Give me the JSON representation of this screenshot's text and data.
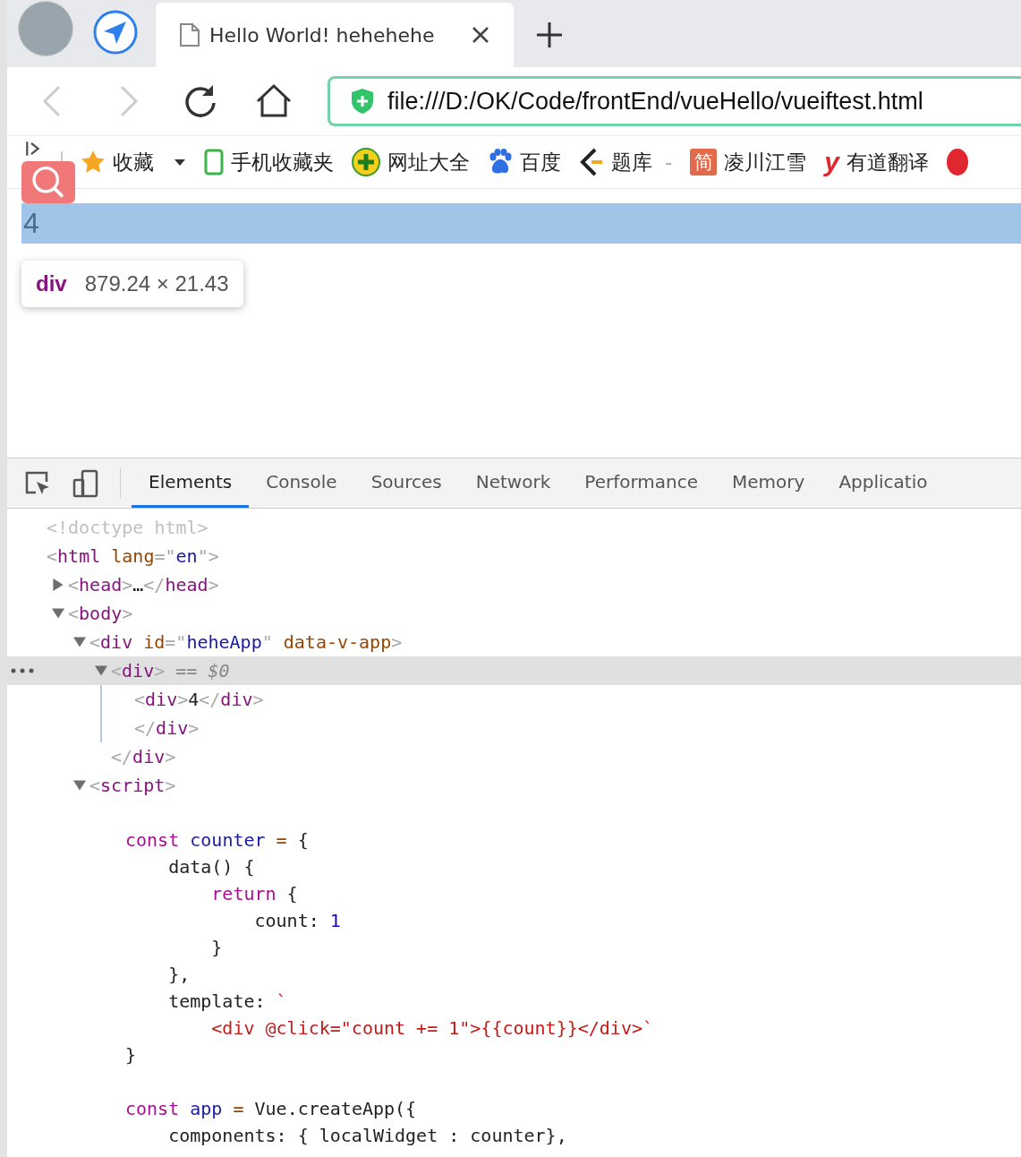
{
  "browser_tab": {
    "title": "Hello World! hehehehe",
    "selected": true
  },
  "address_bar": {
    "value": "file:///D:/OK/Code/frontEnd/vueHello/vueiftest.html"
  },
  "bookmarks": [
    {
      "kind": "star",
      "label": "收藏",
      "dropdown": true
    },
    {
      "kind": "phone",
      "label": "手机收藏夹"
    },
    {
      "kind": "plus",
      "label": "网址大全"
    },
    {
      "kind": "paw",
      "label": "百度"
    },
    {
      "kind": "bracket",
      "label": "题库",
      "suffix": "-"
    },
    {
      "kind": "badge",
      "icon_text": "简",
      "label": "凌川江雪"
    },
    {
      "kind": "letter",
      "icon_text": "y",
      "label": "有道翻译"
    },
    {
      "kind": "dot"
    }
  ],
  "page": {
    "content": "4",
    "tooltip": {
      "tag": "div",
      "size": "879.24 × 21.43"
    }
  },
  "devtools": {
    "tabs": [
      {
        "label": "Elements",
        "selected": true
      },
      {
        "label": "Console",
        "selected": false
      },
      {
        "label": "Sources",
        "selected": false
      },
      {
        "label": "Network",
        "selected": false
      },
      {
        "label": "Performance",
        "selected": false
      },
      {
        "label": "Memory",
        "selected": false
      },
      {
        "label": "Applicatio",
        "selected": false
      }
    ],
    "dom_tree": [
      {
        "selected": false,
        "tokens": [
          {
            "kind": "doctype",
            "text": "<!doctype html>"
          }
        ]
      },
      {
        "selected": false,
        "tokens": [
          {
            "kind": "punct",
            "text": "<"
          },
          {
            "kind": "tag",
            "text": "html"
          },
          {
            "kind": "attr",
            "text": " lang"
          },
          {
            "kind": "punct",
            "text": "=\""
          },
          {
            "kind": "value",
            "text": "en"
          },
          {
            "kind": "punct",
            "text": "\">"
          }
        ],
        "children": [
          {
            "selected": false,
            "expanded": false,
            "tokens": [
              {
                "kind": "punct",
                "text": "<"
              },
              {
                "kind": "tag",
                "text": "head"
              },
              {
                "kind": "punct",
                "text": ">"
              },
              {
                "kind": "text",
                "text": "…"
              },
              {
                "kind": "punct",
                "text": "</"
              },
              {
                "kind": "tag",
                "text": "head"
              },
              {
                "kind": "punct",
                "text": ">"
              }
            ]
          },
          {
            "selected": false,
            "expanded": true,
            "tokens": [
              {
                "kind": "punct",
                "text": "<"
              },
              {
                "kind": "tag",
                "text": "body"
              },
              {
                "kind": "punct",
                "text": ">"
              }
            ],
            "children": [
              {
                "selected": false,
                "expanded": true,
                "tokens": [
                  {
                    "kind": "punct",
                    "text": "<"
                  },
                  {
                    "kind": "tag",
                    "text": "div"
                  },
                  {
                    "kind": "attr",
                    "text": " id"
                  },
                  {
                    "kind": "punct",
                    "text": "=\""
                  },
                  {
                    "kind": "value",
                    "text": "heheApp"
                  },
                  {
                    "kind": "punct",
                    "text": "\""
                  },
                  {
                    "kind": "attr",
                    "text": " data-v-app"
                  },
                  {
                    "kind": "punct",
                    "text": ">"
                  }
                ],
                "children": [
                  {
                    "selected": true,
                    "expanded": true,
                    "tokens": [
                      {
                        "kind": "punct",
                        "text": "<"
                      },
                      {
                        "kind": "tag",
                        "text": "div"
                      },
                      {
                        "kind": "punct",
                        "text": ">"
                      },
                      {
                        "kind": "ref",
                        "text": " == $0"
                      }
                    ],
                    "children": [
                      {
                        "selected": false,
                        "tokens": [
                          {
                            "kind": "punct",
                            "text": "<"
                          },
                          {
                            "kind": "tag",
                            "text": "div"
                          },
                          {
                            "kind": "punct",
                            "text": ">"
                          },
                          {
                            "kind": "text",
                            "text": "4"
                          },
                          {
                            "kind": "punct",
                            "text": "</"
                          },
                          {
                            "kind": "tag",
                            "text": "div"
                          },
                          {
                            "kind": "punct",
                            "text": ">"
                          }
                        ]
                      },
                      {
                        "selected": false,
                        "tokens": [
                          {
                            "kind": "punct",
                            "text": "</"
                          },
                          {
                            "kind": "tag",
                            "text": "div"
                          },
                          {
                            "kind": "punct",
                            "text": ">"
                          }
                        ]
                      }
                    ]
                  },
                  {
                    "selected": false,
                    "tokens": [
                      {
                        "kind": "punct",
                        "text": "</"
                      },
                      {
                        "kind": "tag",
                        "text": "div"
                      },
                      {
                        "kind": "punct",
                        "text": ">"
                      }
                    ]
                  }
                ]
              },
              {
                "selected": false,
                "expanded": true,
                "tokens": [
                  {
                    "kind": "punct",
                    "text": "<"
                  },
                  {
                    "kind": "tag",
                    "text": "script"
                  },
                  {
                    "kind": "punct",
                    "text": ">"
                  }
                ],
                "code_blocks": [
                  [
                    {
                      "tokens": [
                        {
                          "kind": "keyword",
                          "text": "const"
                        },
                        {
                          "kind": "variable",
                          "text": " counter"
                        },
                        {
                          "kind": "operator",
                          "text": " ="
                        },
                        {
                          "kind": "text",
                          "text": " {"
                        }
                      ]
                    },
                    {
                      "tokens": [
                        {
                          "kind": "text",
                          "text": "    data() {"
                        }
                      ]
                    },
                    {
                      "tokens": [
                        {
                          "kind": "keyword",
                          "text": "        return"
                        },
                        {
                          "kind": "text",
                          "text": " {"
                        }
                      ]
                    },
                    {
                      "tokens": [
                        {
                          "kind": "text",
                          "text": "            count: "
                        },
                        {
                          "kind": "number",
                          "text": "1"
                        }
                      ]
                    },
                    {
                      "tokens": [
                        {
                          "kind": "text",
                          "text": "        }"
                        }
                      ]
                    },
                    {
                      "tokens": [
                        {
                          "kind": "text",
                          "text": "    },"
                        }
                      ]
                    },
                    {
                      "tokens": [
                        {
                          "kind": "text",
                          "text": "    template: "
                        },
                        {
                          "kind": "string",
                          "text": "`"
                        }
                      ]
                    },
                    {
                      "tokens": [
                        {
                          "kind": "string",
                          "text": "        <div @click=\"count += 1\">{{count}}</div>`"
                        }
                      ]
                    },
                    {
                      "tokens": [
                        {
                          "kind": "text",
                          "text": "}"
                        }
                      ]
                    }
                  ],
                  [
                    {
                      "tokens": [
                        {
                          "kind": "keyword",
                          "text": "const"
                        },
                        {
                          "kind": "variable",
                          "text": " app"
                        },
                        {
                          "kind": "operator",
                          "text": " ="
                        },
                        {
                          "kind": "text",
                          "text": " Vue.createApp({"
                        }
                      ]
                    },
                    {
                      "tokens": [
                        {
                          "kind": "text",
                          "text": "    components: { localWidget : counter},"
                        }
                      ]
                    }
                  ]
                ]
              }
            ]
          }
        ]
      }
    ]
  }
}
